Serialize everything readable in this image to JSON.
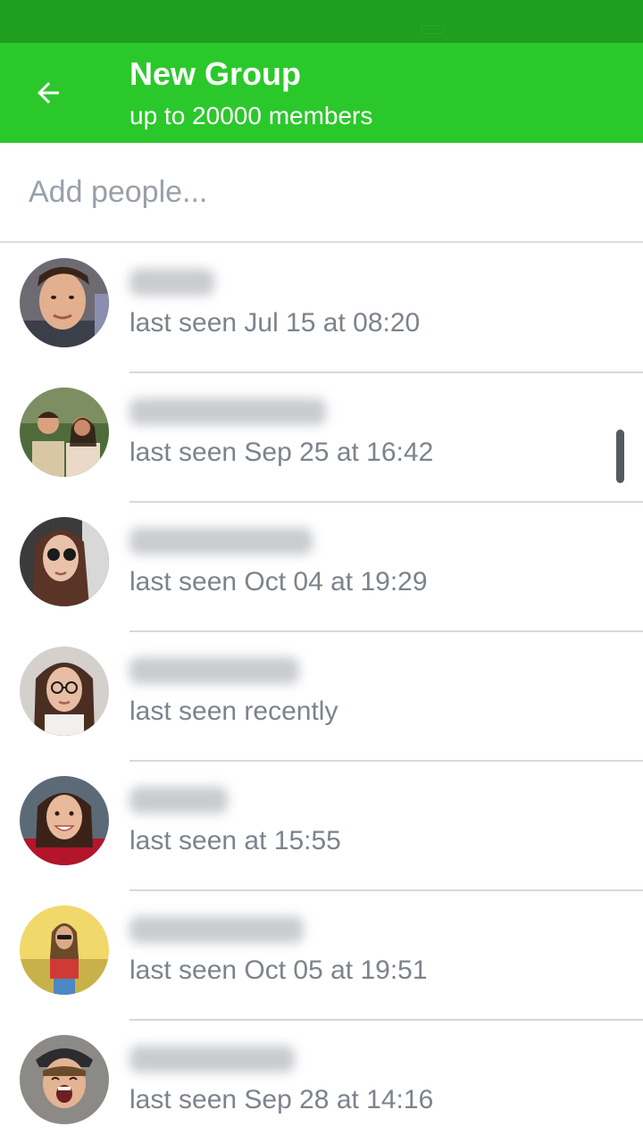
{
  "header": {
    "back_icon": "arrow-left-icon",
    "title": "New Group",
    "subtitle": "up to 20000 members"
  },
  "search": {
    "placeholder": "Add people...",
    "value": ""
  },
  "colors": {
    "status_bar": "#1f9e1f",
    "app_bar": "#2bc82b",
    "secondary_text": "#7c838c"
  },
  "contacts": [
    {
      "last_seen": "last seen Jul 15 at 08:20"
    },
    {
      "last_seen": "last seen Sep 25 at 16:42"
    },
    {
      "last_seen": "last seen Oct 04 at 19:29"
    },
    {
      "last_seen": "last seen recently"
    },
    {
      "last_seen": "last seen at 15:55"
    },
    {
      "last_seen": "last seen Oct 05 at 19:51"
    },
    {
      "last_seen": "last seen Sep 28 at 14:16"
    }
  ]
}
